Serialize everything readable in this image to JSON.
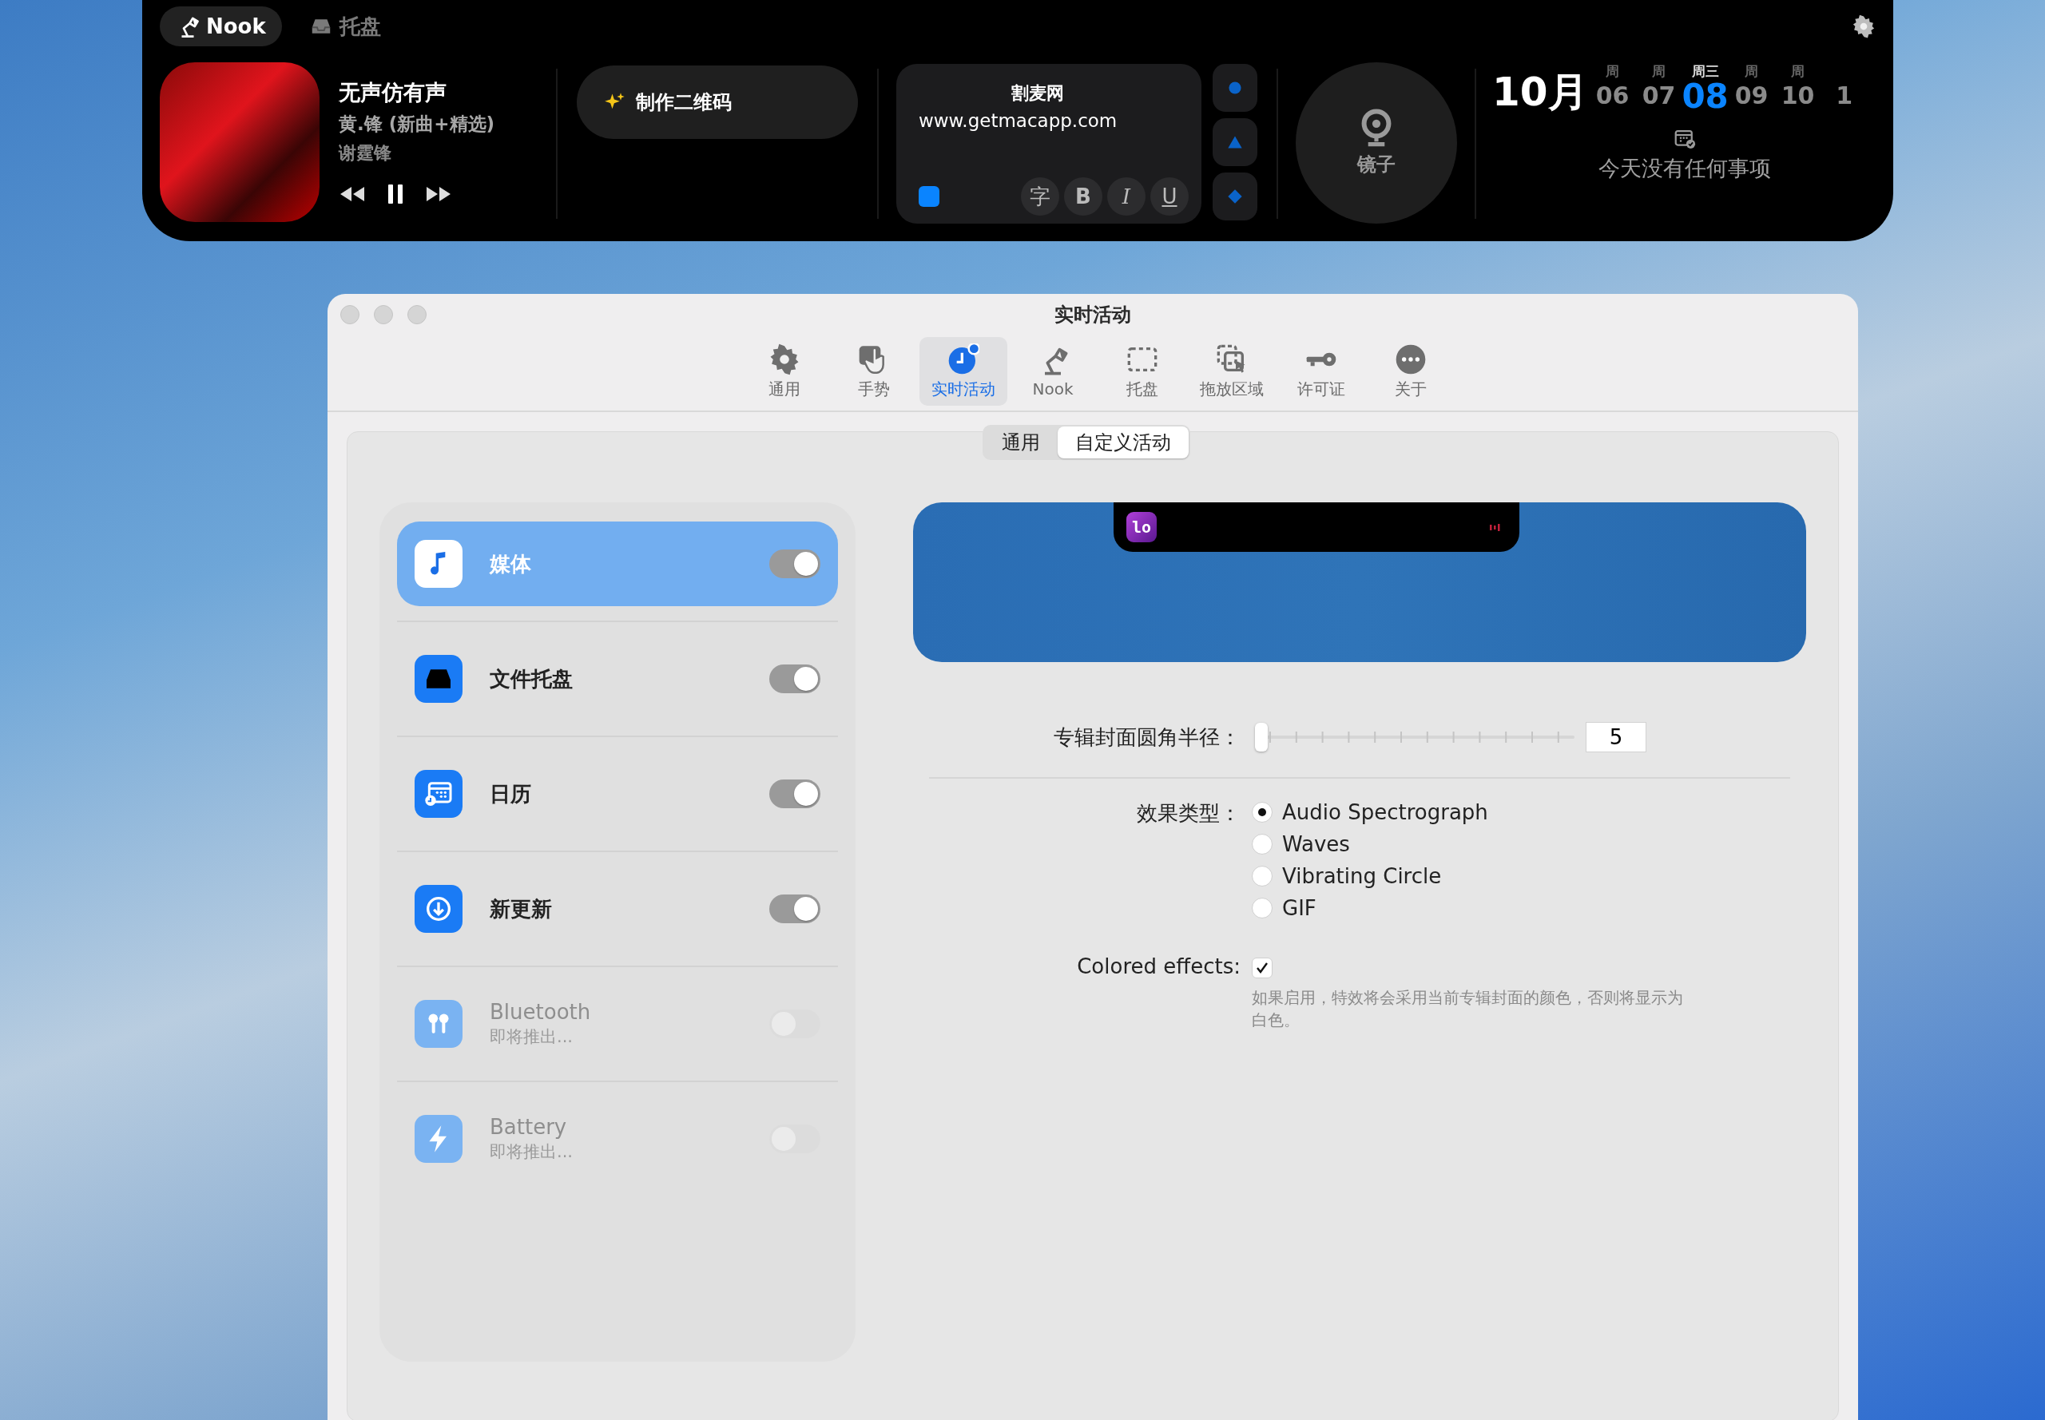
{
  "topbar": {
    "tabs": [
      {
        "label": "Nook",
        "kind": "lamp",
        "selected": true
      },
      {
        "label": "托盘",
        "kind": "tray",
        "selected": false
      }
    ],
    "music": {
      "title": "无声仿有声",
      "album": "黄.锋 (新曲+精选)",
      "artist": "谢霆锋",
      "playing": true
    },
    "qr_button": {
      "label": "制作二维码"
    },
    "note": {
      "title": "割麦网",
      "body": "www.getmacapp.com",
      "format_buttons": [
        {
          "kind": "char",
          "label": "字"
        },
        {
          "kind": "bold",
          "label": "B"
        },
        {
          "kind": "italic",
          "label": "I"
        },
        {
          "kind": "underline",
          "label": "U"
        }
      ]
    },
    "shapes": [
      {
        "kind": "circle"
      },
      {
        "kind": "triangle"
      },
      {
        "kind": "diamond"
      }
    ],
    "mirror": {
      "label": "镜子"
    },
    "calendar": {
      "month": "10月",
      "days": [
        {
          "weekday": "周",
          "day": "06",
          "selected": false
        },
        {
          "weekday": "周",
          "day": "07",
          "selected": false
        },
        {
          "weekday": "周三",
          "day": "08",
          "selected": true
        },
        {
          "weekday": "周",
          "day": "09",
          "selected": false
        },
        {
          "weekday": "周",
          "day": "10",
          "selected": false
        },
        {
          "day": "1",
          "selected": false
        }
      ],
      "empty_text": "今天没有任何事项"
    }
  },
  "window": {
    "title": "实时活动",
    "toolbar": [
      {
        "label": "通用",
        "kind": "gear",
        "selected": false
      },
      {
        "label": "手势",
        "kind": "hand",
        "selected": false
      },
      {
        "label": "实时活动",
        "kind": "live",
        "selected": true
      },
      {
        "label": "Nook",
        "kind": "lamp",
        "selected": false
      },
      {
        "label": "托盘",
        "kind": "dashed",
        "selected": false
      },
      {
        "label": "拖放区域",
        "kind": "drop",
        "selected": false
      },
      {
        "label": "许可证",
        "kind": "key",
        "selected": false
      },
      {
        "label": "关于",
        "kind": "more",
        "selected": false
      }
    ]
  },
  "segments": [
    {
      "label": "通用",
      "selected": false
    },
    {
      "label": "自定义活动",
      "selected": true
    }
  ],
  "activities": [
    {
      "name": "媒体",
      "kind": "music",
      "on": true,
      "selected": true,
      "disabled": false
    },
    {
      "name": "文件托盘",
      "kind": "tray",
      "on": true,
      "selected": false,
      "disabled": false
    },
    {
      "name": "日历",
      "kind": "calendar",
      "on": true,
      "selected": false,
      "disabled": false
    },
    {
      "name": "新更新",
      "kind": "download",
      "on": true,
      "selected": false,
      "disabled": false
    },
    {
      "name": "Bluetooth",
      "subtitle": "即将推出...",
      "kind": "earbuds",
      "on": false,
      "selected": false,
      "disabled": true
    },
    {
      "name": "Battery",
      "subtitle": "即将推出...",
      "kind": "bolt",
      "on": false,
      "selected": false,
      "disabled": true
    }
  ],
  "preview": {
    "app_icon_text": "lo"
  },
  "corner_radius": {
    "label": "专辑封面圆角半径：",
    "level": 0,
    "value": "5"
  },
  "effect": {
    "label": "效果类型：",
    "options": [
      {
        "label": "Audio Spectrograph",
        "selected": true
      },
      {
        "label": "Waves",
        "selected": false
      },
      {
        "label": "Vibrating Circle",
        "selected": false
      },
      {
        "label": "GIF",
        "selected": false
      }
    ]
  },
  "colored_effects": {
    "label": "Colored effects:",
    "checked": true,
    "help": "如果启用，特效将会采用当前专辑封面的颜色，否则将显示为白色。"
  }
}
